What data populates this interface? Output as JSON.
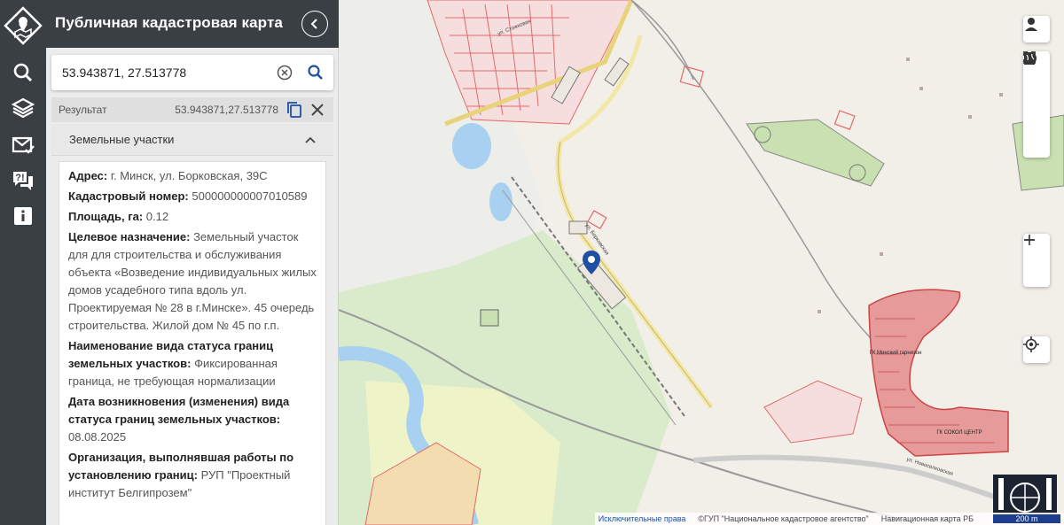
{
  "app": {
    "title": "Публичная кадастровая карта"
  },
  "search": {
    "value": "53.943871, 27.513778"
  },
  "result": {
    "label": "Результат",
    "coords": "53.943871,27.513778"
  },
  "section": {
    "title": "Земельные участки"
  },
  "parcel": {
    "address_label": "Адрес:",
    "address_value": "г. Минск, ул. Борковская, 39С",
    "cadastral_label": "Кадастровый номер:",
    "cadastral_value": "500000000007010589",
    "area_label": "Площадь, га:",
    "area_value": "0.12",
    "purpose_label": "Целевое назначение:",
    "purpose_value": "Земельный участок для для строительства и обслуживания объекта «Возведение индивидуальных жилых домов усадебного типа вдоль ул. Проектируемая № 28 в г.Минске». 45 очередь строительства. Жилой дом № 45 по г.п.",
    "boundary_status_label": "Наименование вида статуса границ земельных участков:",
    "boundary_status_value": "Фиксированная граница, не требующая нормализации",
    "status_date_label": "Дата возникновения (изменения) вида статуса границ земельных участков:",
    "status_date_value": "08.08.2025",
    "org_label": "Организация, выполнявшая работы по установлению границ:",
    "org_value": "РУП \"Проектный институт Белгипрозем\""
  },
  "map": {
    "labels": {
      "garrison": "ГК Минский гарнизон",
      "sokol": "ГК СОКОЛ ЦЕНТР",
      "street": "ул. Борковская",
      "street2": "ул. Новоселковская",
      "street3": "ул. Стожковая"
    },
    "attribution": {
      "exclusive_rights": "Исключительные права",
      "copyright": "©ГУП \"Национальное кадастровое агентство\"",
      "nav_map": "Навигационная карта РБ",
      "scale": "200 m"
    }
  },
  "icons": {
    "rail": [
      "logo-icon",
      "search-icon",
      "layers-icon",
      "mail-icon",
      "question-icon",
      "info-icon"
    ],
    "controls": [
      "user-icon",
      "fullscreen-icon",
      "measure-icon",
      "document-icon",
      "globe-icon",
      "zoom-in-icon",
      "zoom-out-icon",
      "locate-icon"
    ]
  },
  "colors": {
    "rail_bg": "#3a3f44",
    "accent": "#1d4fa3",
    "parcel_red": "#e05050",
    "green_area": "#d8e8c8",
    "water": "#a8d0f0"
  }
}
